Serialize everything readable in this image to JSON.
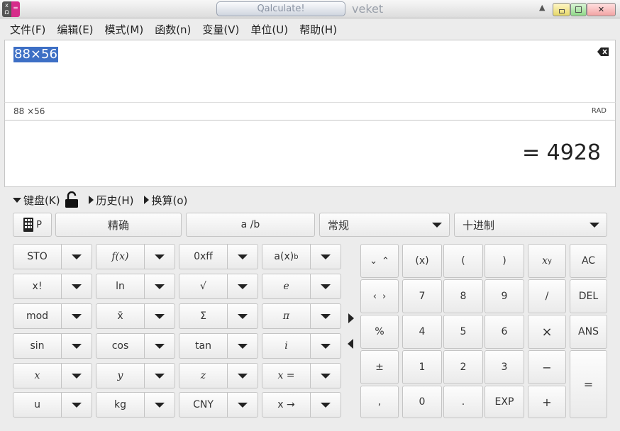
{
  "window": {
    "title": "Qalculate!",
    "subtitle": "veket",
    "app_icon_left": "x Ω",
    "app_icon_right": "="
  },
  "menu": [
    "文件(F)",
    "编辑(E)",
    "模式(M)",
    "函数(n)",
    "变量(V)",
    "单位(U)",
    "帮助(H)"
  ],
  "expression": "88×56",
  "parsed_expression": "88 ×56",
  "angle_unit": "RAD",
  "result": "= 4928",
  "toggles": {
    "keypad": "键盘(K)",
    "history": "历史(H)",
    "conversion": "换算(o)"
  },
  "toolbar": {
    "keypad_mode_label": "P",
    "exact_label": "精确",
    "fraction_label": "a  /b",
    "format_combo": "常规",
    "base_combo": "十进制"
  },
  "left_keys": [
    [
      "STO",
      "f(x)",
      "0xff",
      "a(x)"
    ],
    [
      "x!",
      "ln",
      "√",
      "e"
    ],
    [
      "mod",
      "x̄",
      "Σ",
      "π"
    ],
    [
      "sin",
      "cos",
      "tan",
      "i"
    ],
    [
      "x",
      "y",
      "z",
      "x ="
    ],
    [
      "u",
      "kg",
      "CNY",
      "x →"
    ]
  ],
  "left_key_superscript": "b",
  "right_keys": {
    "paren_group": "(x)",
    "open_paren": "(",
    "close_paren": ")",
    "power": "x",
    "power_sup": "y",
    "ac": "AC",
    "seven": "7",
    "eight": "8",
    "nine": "9",
    "divide": "/",
    "del": "DEL",
    "percent": "%",
    "four": "4",
    "five": "5",
    "six": "6",
    "multiply": "×",
    "ans": "ANS",
    "plusminus": "±",
    "one": "1",
    "two": "2",
    "three": "3",
    "minus": "−",
    "comma": ",",
    "zero": "0",
    "dot": ".",
    "exp": "EXP",
    "plus": "+",
    "equals": "="
  },
  "icons": {
    "clear": "backspace-icon",
    "lock": "unlock-icon",
    "keypad": "keypad-icon"
  }
}
